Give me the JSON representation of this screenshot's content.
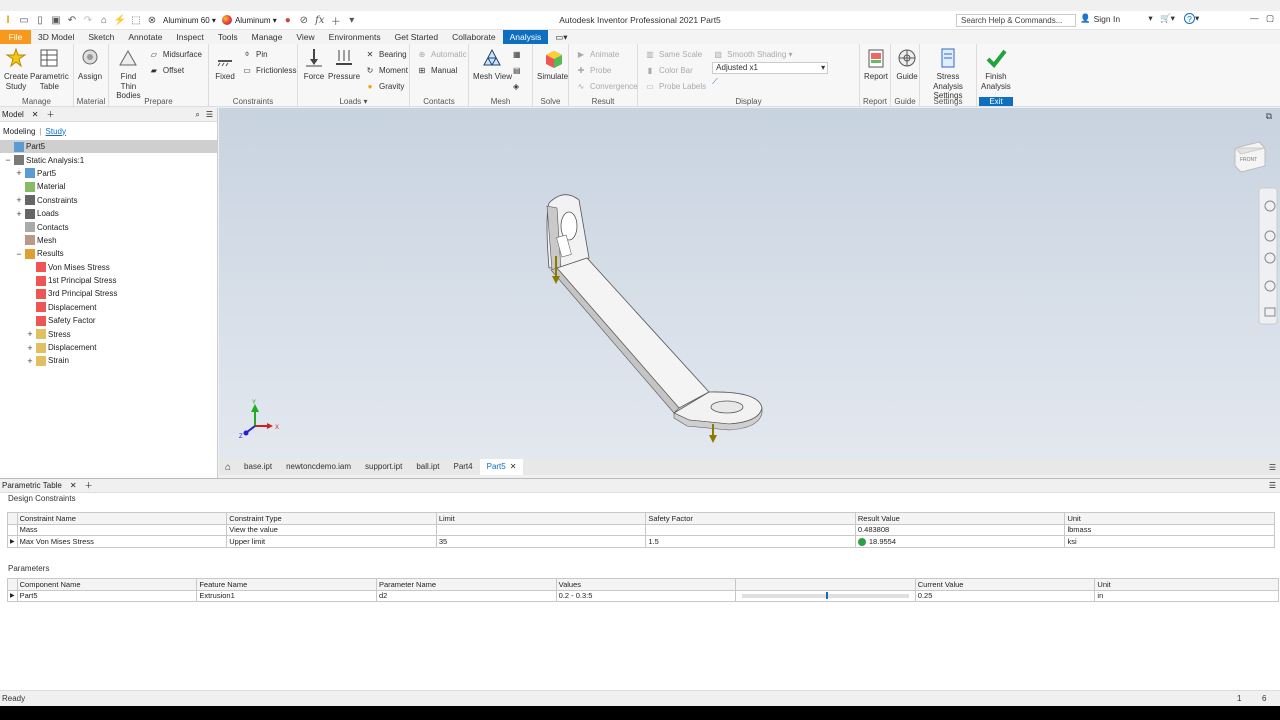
{
  "colors": {
    "accent": "#0e6fc0",
    "file_tab": "#f8981d",
    "finish_check": "#1fa33a",
    "load_arrow": "#8a7a00",
    "result_green": "#2ea043"
  },
  "titlebar": {
    "material": "Aluminum 60",
    "appearance": "Aluminum",
    "title": "Autodesk Inventor Professional 2021   Part5",
    "search_placeholder": "Search Help & Commands...",
    "signin": "Sign In",
    "help": "?"
  },
  "menu": [
    "File",
    "3D Model",
    "Sketch",
    "Annotate",
    "Inspect",
    "Tools",
    "Manage",
    "View",
    "Environments",
    "Get Started",
    "Collaborate",
    "Analysis"
  ],
  "ribbon": {
    "manage": {
      "create_study": "Create\nStudy",
      "param_table": "Parametric\nTable",
      "label": "Manage"
    },
    "material": {
      "assign": "Assign",
      "label": "Material"
    },
    "prepare": {
      "find_thin": "Find Thin\nBodies",
      "midsurface": "Midsurface",
      "offset": "Offset",
      "label": "Prepare"
    },
    "constraints": {
      "fixed": "Fixed",
      "pin": "Pin",
      "frictionless": "Frictionless",
      "label": "Constraints"
    },
    "loads": {
      "force": "Force",
      "pressure": "Pressure",
      "bearing": "Bearing",
      "moment": "Moment",
      "gravity": "Gravity",
      "label": "Loads"
    },
    "contacts": {
      "automatic": "Automatic",
      "manual": "Manual",
      "label": "Contacts"
    },
    "mesh": {
      "mesh_view": "Mesh View",
      "label": "Mesh"
    },
    "solve": {
      "simulate": "Simulate",
      "label": "Solve"
    },
    "result": {
      "animate": "Animate",
      "probe": "Probe",
      "convergence": "Convergence",
      "label": "Result"
    },
    "display": {
      "same_scale": "Same Scale",
      "color_bar": "Color Bar",
      "probe_labels": "Probe Labels",
      "smooth_shading": "Smooth Shading",
      "adjusted": "Adjusted x1",
      "label": "Display"
    },
    "report": {
      "report": "Report",
      "label": "Report"
    },
    "guide": {
      "guide": "Guide",
      "label": "Guide"
    },
    "settings": {
      "stress_settings": "Stress Analysis\nSettings",
      "label": "Settings"
    },
    "exit": {
      "finish": "Finish\nAnalysis",
      "label": "Exit"
    }
  },
  "browser": {
    "title": "Model",
    "tab_modeling": "Modeling",
    "tab_study": "Study",
    "tree": [
      {
        "label": "Part5",
        "indent": 0,
        "exp": "",
        "sel": true
      },
      {
        "label": "Static Analysis:1",
        "indent": 0,
        "exp": "−"
      },
      {
        "label": "Part5",
        "indent": 1,
        "exp": "+"
      },
      {
        "label": "Material",
        "indent": 1,
        "exp": ""
      },
      {
        "label": "Constraints",
        "indent": 1,
        "exp": "+"
      },
      {
        "label": "Loads",
        "indent": 1,
        "exp": "+"
      },
      {
        "label": "Contacts",
        "indent": 1,
        "exp": ""
      },
      {
        "label": "Mesh",
        "indent": 1,
        "exp": ""
      },
      {
        "label": "Results",
        "indent": 1,
        "exp": "−"
      },
      {
        "label": "Von Mises Stress",
        "indent": 2,
        "exp": ""
      },
      {
        "label": "1st Principal Stress",
        "indent": 2,
        "exp": ""
      },
      {
        "label": "3rd Principal Stress",
        "indent": 2,
        "exp": ""
      },
      {
        "label": "Displacement",
        "indent": 2,
        "exp": ""
      },
      {
        "label": "Safety Factor",
        "indent": 2,
        "exp": ""
      },
      {
        "label": "Stress",
        "indent": 2,
        "exp": "+"
      },
      {
        "label": "Displacement",
        "indent": 2,
        "exp": "+"
      },
      {
        "label": "Strain",
        "indent": 2,
        "exp": "+"
      }
    ]
  },
  "viewcube": {
    "face": "FRONT"
  },
  "triad": {
    "x": "X",
    "y": "Y",
    "z": "Z"
  },
  "doc_tabs": [
    "base.ipt",
    "newtoncdemo.iam",
    "support.ipt",
    "ball.ipt",
    "Part4",
    "Part5"
  ],
  "ptable": {
    "title": "Parametric Table",
    "design_constraints_title": "Design Constraints",
    "dc_headers": [
      "Constraint Name",
      "Constraint Type",
      "Limit",
      "Safety Factor",
      "Result Value",
      "Unit"
    ],
    "dc_rows": [
      [
        "Mass",
        "View the value",
        "",
        "",
        "0.483808",
        "lbmass"
      ],
      [
        "Max Von Mises Stress",
        "Upper limit",
        "35",
        "1.5",
        "18.9554",
        "ksi"
      ]
    ],
    "parameters_title": "Parameters",
    "p_headers": [
      "Component Name",
      "Feature Name",
      "Parameter Name",
      "Values",
      "",
      "Current Value",
      "Unit"
    ],
    "p_rows": [
      [
        "Part5",
        "Extrusion1",
        "d2",
        "0.2 - 0.3:5",
        "",
        "0.25",
        "in"
      ]
    ],
    "slider_fraction": 0.5
  },
  "status": {
    "text": "Ready",
    "count1": "1",
    "count2": "6"
  }
}
